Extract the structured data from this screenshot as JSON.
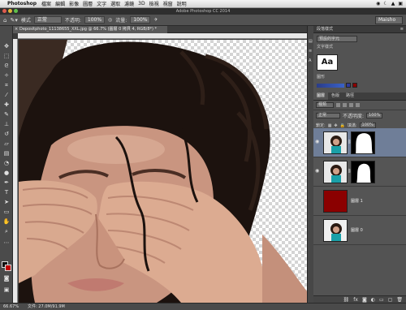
{
  "menubar": {
    "app": "Photoshop",
    "items": [
      "檔案",
      "編輯",
      "影像",
      "圖層",
      "文字",
      "選取",
      "濾鏡",
      "3D",
      "檢視",
      "視窗",
      "說明"
    ],
    "status_right": [
      "◉",
      "☾",
      "▲",
      "▣"
    ]
  },
  "titlebar": {
    "title": "Adobe Photoshop CC 2014"
  },
  "options": {
    "mode_label": "模式",
    "mode_value": "正常",
    "opacity_label": "不透明:",
    "opacity_value": "100%",
    "flow_label": "流量:",
    "flow_value": "100%",
    "workspace": "Maisho"
  },
  "document": {
    "tab_title": "Depositphoto_11138655_XXL.jpg @ 66.7% (圖層 0 拷貝 4, RGB/8*) *",
    "zoom": "66.67%",
    "doc_size": "文件: 27.0M/91.9M"
  },
  "panels": {
    "character_title": "段落樣式",
    "character_dropdown": "預設的字元",
    "character_sub": "文字樣式",
    "aa_label": "Aa",
    "swatches_sub": "圖形",
    "layers_tabs": [
      "圖層",
      "色版",
      "路徑"
    ],
    "filter_kind": "種類",
    "blend_mode": "正常",
    "opacity_label": "不透明度:",
    "opacity_value": "100%",
    "lock_label": "鎖定:",
    "fill_label": "填滿:",
    "fill_value": "100%",
    "layers": [
      {
        "name": "",
        "type": "photo-mask",
        "selected": true
      },
      {
        "name": "",
        "type": "photo-mask",
        "selected": false
      },
      {
        "name": "圖層 1",
        "type": "color",
        "selected": false
      },
      {
        "name": "圖層 0",
        "type": "photo",
        "selected": false
      }
    ]
  },
  "colors": {
    "layer_fill": "#8b0000",
    "background_swatch": "#c00000"
  }
}
